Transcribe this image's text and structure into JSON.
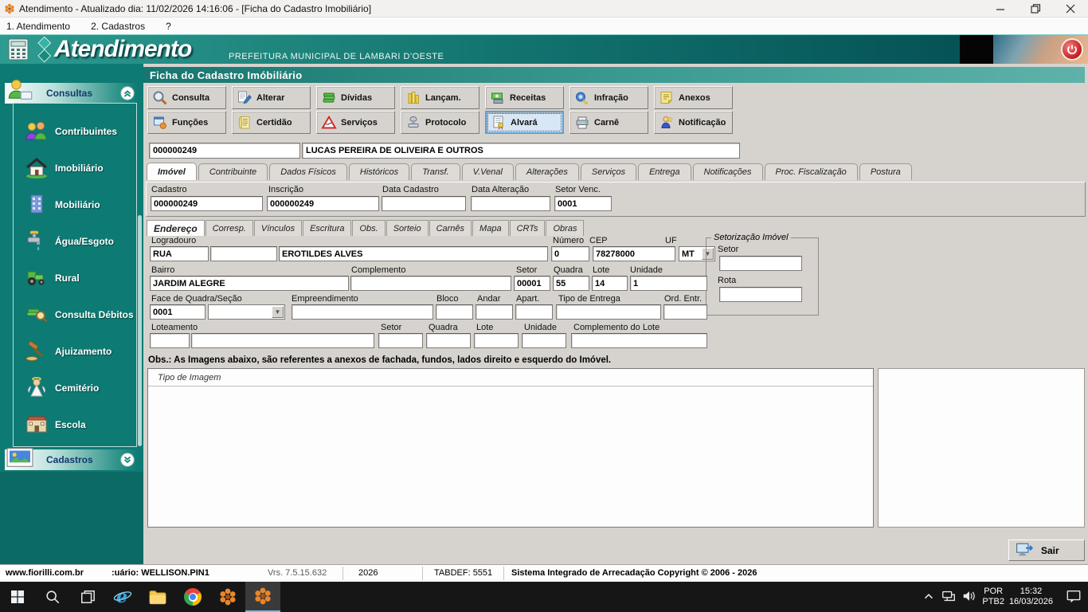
{
  "window": {
    "title": "Atendimento - Atualizado dia: 11/02/2026 14:16:06 - [Ficha do Cadastro Imobiliário]",
    "menu": [
      "1. Atendimento",
      "2. Cadastros",
      "?"
    ]
  },
  "banner": {
    "logo": "Atendimento",
    "subtitle": "PREFEITURA MUNICIPAL DE LAMBARI D'OESTE"
  },
  "sidebar": {
    "consultas_label": "Consultas",
    "items": [
      "Contribuintes",
      "Imobiliário",
      "Mobiliário",
      "Água/Esgoto",
      "Rural",
      "Consulta Débitos",
      "Ajuizamento",
      "Cemitério",
      "Escola"
    ],
    "cadastros_label": "Cadastros"
  },
  "page": {
    "title": "Ficha do Cadastro Imóbiliário"
  },
  "toolbar": {
    "row1": [
      "Consulta",
      "Alterar",
      "Dívidas",
      "Lançam.",
      "Receitas",
      "Infração",
      "Anexos"
    ],
    "row2": [
      "Funções",
      "Certidão",
      "Serviços",
      "Protocolo",
      "Alvará",
      "Carnê",
      "Notificação"
    ]
  },
  "record": {
    "code": "000000249",
    "name": "LUCAS PEREIRA DE OLIVEIRA E OUTROS"
  },
  "tabs": [
    "Imóvel",
    "Contribuinte",
    "Dados Físicos",
    "Históricos",
    "Transf.",
    "V.Venal",
    "Alterações",
    "Serviços",
    "Entrega",
    "Notificações",
    "Proc. Fiscalização",
    "Postura"
  ],
  "cadastro": {
    "cadastro_label": "Cadastro",
    "cadastro_value": "000000249",
    "inscricao_label": "Inscrição",
    "inscricao_value": "000000249",
    "data_cadastro_label": "Data Cadastro",
    "data_cadastro_value": "",
    "data_alteracao_label": "Data Alteração",
    "data_alteracao_value": "",
    "setor_venc_label": "Setor Venc.",
    "setor_venc_value": "0001"
  },
  "subtabs": [
    "Endereço",
    "Corresp.",
    "Vínculos",
    "Escritura",
    "Obs.",
    "Sorteio",
    "Carnês",
    "Mapa",
    "CRTs",
    "Obras"
  ],
  "address": {
    "logradouro_label": "Logradouro",
    "tipo_value": "RUA",
    "titulo_value": "",
    "nome_value": "EROTILDES ALVES",
    "numero_label": "Número",
    "numero_value": "0",
    "cep_label": "CEP",
    "cep_value": "78278000",
    "uf_label": "UF",
    "uf_value": "MT",
    "bairro_label": "Bairro",
    "bairro_value": "JARDIM ALEGRE",
    "complemento_label": "Complemento",
    "complemento_value": "",
    "setor_label": "Setor",
    "setor_value": "00001",
    "quadra_label": "Quadra",
    "quadra_value": "55",
    "lote_label": "Lote",
    "lote_value": "14",
    "unidade_label": "Unidade",
    "unidade_value": "1",
    "face_label": "Face de Quadra/Seção",
    "face_value": "0001",
    "face_combo_value": "",
    "empreendimento_label": "Empreendimento",
    "empreendimento_value": "",
    "bloco_label": "Bloco",
    "bloco_value": "",
    "andar_label": "Andar",
    "andar_value": "",
    "apart_label": "Apart.",
    "apart_value": "",
    "tipo_entrega_label": "Tipo de Entrega",
    "tipo_entrega_value": "",
    "ord_entr_label": "Ord. Entr.",
    "ord_entr_value": "",
    "loteamento_label": "Loteamento",
    "loteamento_cod_value": "",
    "loteamento_value": "",
    "setor2_label": "Setor",
    "setor2_value": "",
    "quadra2_label": "Quadra",
    "quadra2_value": "",
    "lote2_label": "Lote",
    "lote2_value": "",
    "unidade2_label": "Unidade",
    "unidade2_value": "",
    "compl_lote_label": "Complemento do Lote",
    "compl_lote_value": ""
  },
  "setorizacao": {
    "title": "Setorização Imóvel",
    "setor_label": "Setor",
    "setor_value": "",
    "rota_label": "Rota",
    "rota_value": ""
  },
  "obs_text": "Obs.: As Imagens abaixo, são referentes a anexos de fachada, fundos, lados direito e esquerdo do Imóvel.",
  "images": {
    "header": "Tipo de Imagem"
  },
  "footer": {
    "sair_label": "Sair"
  },
  "statusbar": {
    "site": "www.fiorilli.com.br",
    "user": ":uário: WELLISON.PIN1",
    "version": "Vrs. 7.5.15.632",
    "year": "2026",
    "tabdef": "TABDEF: 5551",
    "copyright": "Sistema Integrado de Arrecadação Copyright © 2006 - 2026"
  },
  "tray": {
    "lang_top": "POR",
    "lang_bottom": "PTB2",
    "time": "15:32",
    "date": "16/03/2026"
  }
}
